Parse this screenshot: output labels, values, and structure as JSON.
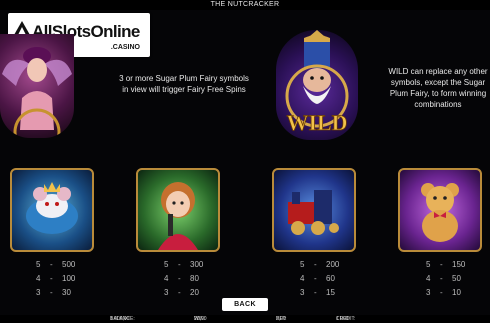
{
  "title": "THE NUTCRACKER",
  "logo": {
    "brand": "AllSlotsOnline",
    "sub": ".CASINO"
  },
  "scatter_text": "3 or more Sugar Plum Fairy symbols in view will trigger Fairy Free Spins",
  "wild": {
    "label": "WILD",
    "text": "WILD can replace any other symbols, except the Sugar Plum Fairy, to form winning combinations"
  },
  "symbols": [
    {
      "icon": "mouse-king-icon",
      "pays": [
        {
          "n": "5",
          "v": "500"
        },
        {
          "n": "4",
          "v": "100"
        },
        {
          "n": "3",
          "v": "30"
        }
      ]
    },
    {
      "icon": "clara-icon",
      "pays": [
        {
          "n": "5",
          "v": "300"
        },
        {
          "n": "4",
          "v": "80"
        },
        {
          "n": "3",
          "v": "20"
        }
      ]
    },
    {
      "icon": "toy-train-icon",
      "pays": [
        {
          "n": "5",
          "v": "200"
        },
        {
          "n": "4",
          "v": "60"
        },
        {
          "n": "3",
          "v": "15"
        }
      ]
    },
    {
      "icon": "teddy-bear-icon",
      "pays": [
        {
          "n": "5",
          "v": "150"
        },
        {
          "n": "4",
          "v": "50"
        },
        {
          "n": "3",
          "v": "10"
        }
      ]
    }
  ],
  "back_label": "BACK",
  "status": {
    "balance_label": "BALANCE:",
    "balance": "1 000,00",
    "win_label": "WIN:",
    "win": "20,00",
    "bet_label": "BET:",
    "bet": "2,00",
    "credit_label": "CREDIT:",
    "credit": "1 000"
  },
  "colors": {
    "background": "#050507",
    "frame_gold": "#b98b3a"
  }
}
